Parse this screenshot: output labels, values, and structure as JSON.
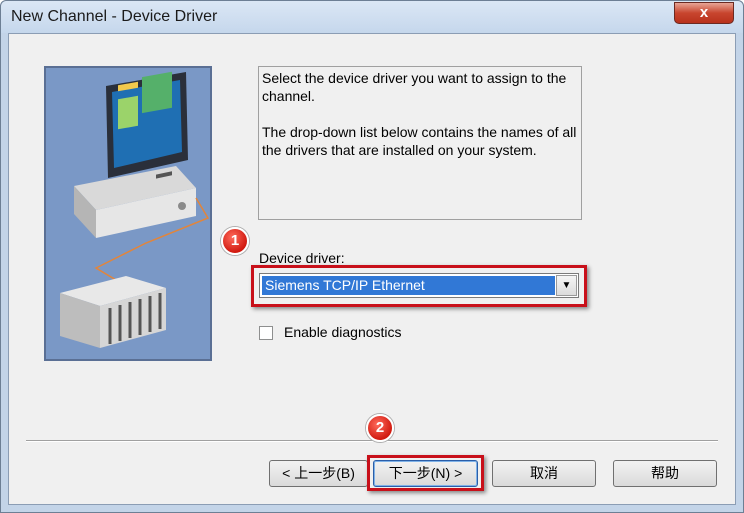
{
  "window": {
    "title": "New Channel - Device Driver",
    "close_label": "x"
  },
  "description": {
    "line1": "Select the device driver you want to assign to the channel.",
    "line2": "The drop-down list below contains the names of all the drivers that are installed on your system."
  },
  "device_driver": {
    "label": "Device driver:",
    "selected": "Siemens TCP/IP Ethernet"
  },
  "diagnostics": {
    "label": "Enable diagnostics",
    "checked": false
  },
  "buttons": {
    "back": "< 上一步(B)",
    "next": "下一步(N) >",
    "cancel": "取消",
    "help": "帮助"
  },
  "annotations": {
    "step1": "1",
    "step2": "2"
  },
  "colors": {
    "highlight": "#c8101a",
    "selection": "#3178d6",
    "badge": "#d11a10"
  },
  "icons": {
    "close": "close-icon",
    "dropdown": "chevron-down-icon"
  }
}
